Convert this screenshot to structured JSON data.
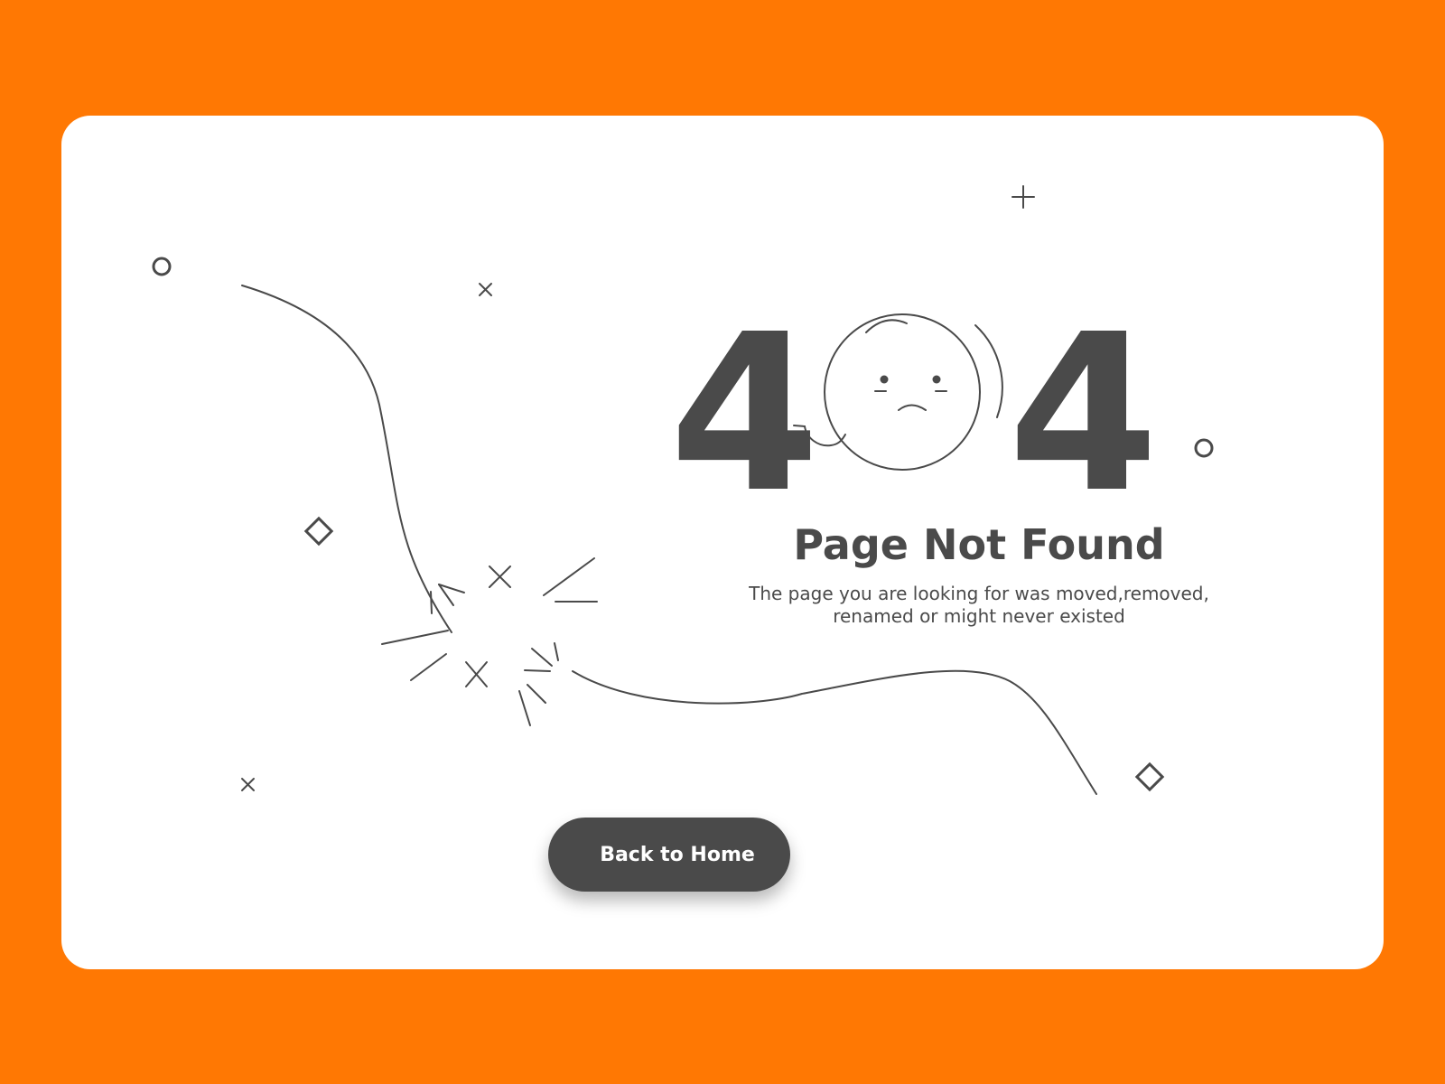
{
  "page": {
    "background_color": "#FF7803",
    "card_color": "#FFFFFF",
    "ink_color": "#4A4A4A"
  },
  "error": {
    "digit_left": "4",
    "digit_right": "4",
    "zero_icon": "sad-face-icon",
    "title": "Page Not Found",
    "message_line1": "The page you are looking for was moved,removed,",
    "message_line2": "renamed or might never existed"
  },
  "actions": {
    "home_label": "Back to Home"
  },
  "decorations": [
    "circle-icon",
    "cross-icon",
    "plus-icon",
    "diamond-icon",
    "broken-wire-icon",
    "spark-icon"
  ]
}
